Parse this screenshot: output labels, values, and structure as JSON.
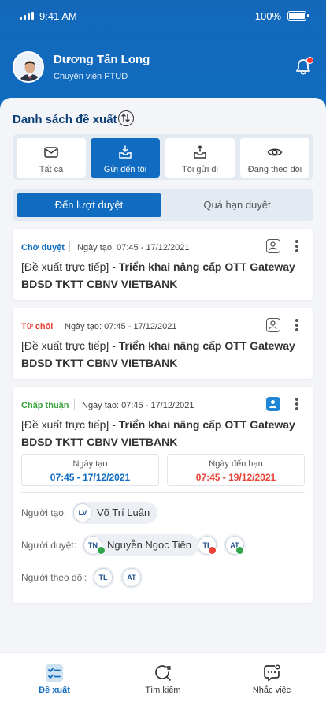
{
  "status_bar": {
    "time": "9:41 AM",
    "battery": "100%"
  },
  "user": {
    "name": "Dương Tấn Long",
    "role": "Chuyên viên PTUD"
  },
  "section": {
    "title": "Danh sách đề xuất"
  },
  "tabs": [
    {
      "label": "Tất cả",
      "icon": "mail-icon",
      "active": false
    },
    {
      "label": "Gửi đến tôi",
      "icon": "inbox-download-icon",
      "active": true
    },
    {
      "label": "Tôi gửi đi",
      "icon": "outbox-upload-icon",
      "active": false
    },
    {
      "label": "Đang theo dõi",
      "icon": "eye-icon",
      "active": false
    }
  ],
  "segments": [
    {
      "label": "Đến lượt duyệt",
      "active": true
    },
    {
      "label": "Quá hạn duyệt",
      "active": false
    }
  ],
  "colors": {
    "primary": "#0f6cc0",
    "pending": "#0f6cc0",
    "rejected": "#e84135",
    "approved": "#3aa43f",
    "due": "#e84135"
  },
  "cards": [
    {
      "status": "Chờ duyệt",
      "created": "Ngày tạo: 07:45 - 17/12/2021",
      "title_prefix": "[Đề xuất trực tiếp] - ",
      "title_bold": "Triển khai nâng cấp OTT Gateway BDSD TKTT CBNV VIETBANK"
    },
    {
      "status": "Từ chối",
      "created": "Ngày tạo: 07:45 - 17/12/2021",
      "title_prefix": "[Đề xuất trực tiếp] - ",
      "title_bold": "Triển khai nâng cấp OTT Gateway BDSD TKTT CBNV VIETBANK"
    },
    {
      "status": "Chấp thuận",
      "created": "Ngày tạo: 07:45 - 17/12/2021",
      "title_prefix": "[Đề xuất trực tiếp] - ",
      "title_bold": "Triển khai nâng cấp OTT Gateway BDSD TKTT CBNV VIETBANK",
      "created_box": {
        "label": "Ngày tạo",
        "value": "07:45 - 17/12/2021"
      },
      "due_box": {
        "label": "Ngày đến hạn",
        "value": "07:45 - 19/12/2021"
      },
      "creator_label": "Người tạo:",
      "creator": {
        "initials": "LV",
        "name": "Võ Trí Luân"
      },
      "approver_label": "Người duyệt:",
      "approvers": [
        {
          "initials": "TN",
          "name": "Nguyễn Ngọc Tiến",
          "state": "approved"
        },
        {
          "initials": "TL",
          "state": "rejected"
        },
        {
          "initials": "AT",
          "state": "approved"
        }
      ],
      "follower_label": "Người theo dõi:",
      "followers": [
        {
          "initials": "TL"
        },
        {
          "initials": "AT"
        }
      ]
    }
  ],
  "bottom_nav": [
    {
      "label": "Đề xuất",
      "icon": "checklist-icon",
      "active": true
    },
    {
      "label": "Tìm kiếm",
      "icon": "search-icon",
      "active": false
    },
    {
      "label": "Nhắc việc",
      "icon": "chat-reminder-icon",
      "active": false
    }
  ]
}
